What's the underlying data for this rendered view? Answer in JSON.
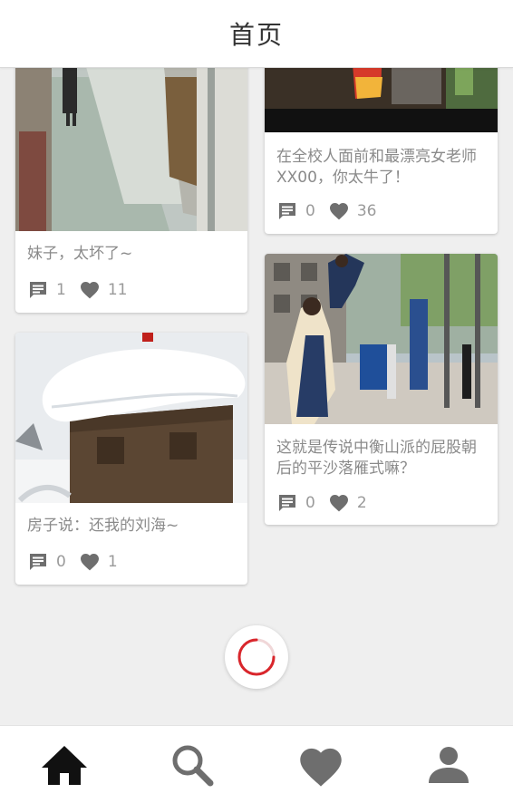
{
  "header": {
    "title": "首页"
  },
  "colors": {
    "accent": "#d9262c",
    "icon_gray": "#6e6e6e",
    "icon_active": "#111111",
    "text_gray": "#8a8a8a"
  },
  "feed": {
    "cards": [
      {
        "title": "妹子，太坏了~",
        "comments": "1",
        "likes": "11"
      },
      {
        "title": "房子说：还我的刘海~",
        "comments": "0",
        "likes": "1"
      },
      {
        "title": "在全校人面前和最漂亮女老师XX00，你太牛了！",
        "comments": "0",
        "likes": "36"
      },
      {
        "title": "这就是传说中衡山派的屁股朝后的平沙落雁式嘛？",
        "comments": "0",
        "likes": "2"
      }
    ]
  },
  "tabbar": {
    "tabs": [
      {
        "icon": "home-icon",
        "active": true
      },
      {
        "icon": "search-icon",
        "active": false
      },
      {
        "icon": "heart-icon",
        "active": false
      },
      {
        "icon": "person-icon",
        "active": false
      }
    ]
  }
}
